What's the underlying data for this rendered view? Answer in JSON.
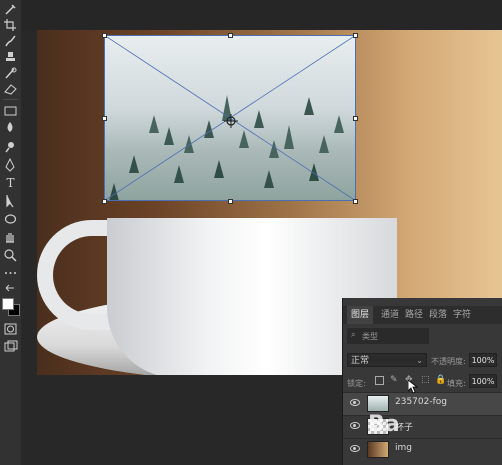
{
  "toolbar": {
    "tools": [
      "eyedropper-tool",
      "crop-tool",
      "brush-tool",
      "clone-stamp-tool",
      "history-brush-tool",
      "eraser-tool",
      "gradient-tool",
      "blur-tool",
      "dodge-tool",
      "pen-tool",
      "type-tool",
      "path-selection-tool",
      "rectangle-tool",
      "hand-tool",
      "zoom-tool",
      "more-tools"
    ],
    "type_tool_glyph": "T"
  },
  "colors": {
    "foreground": "#ffffff",
    "background": "#000000",
    "selection_border": "#4a6fb3"
  },
  "layers_panel": {
    "tabs": [
      "图层",
      "通道",
      "路径",
      "段落",
      "字符"
    ],
    "active_tab": "图层",
    "search_placeholder": "类型",
    "blend_mode": "正常",
    "opacity_label": "不透明度:",
    "opacity_value": "100%",
    "lock_label": "锁定:",
    "fill_label": "填充:",
    "fill_value": "100%",
    "layers": [
      {
        "name": "235702-fog",
        "selected": true
      },
      {
        "name": "杯子",
        "selected": false
      },
      {
        "name": "img",
        "selected": false
      }
    ]
  },
  "watermark": "Ba"
}
